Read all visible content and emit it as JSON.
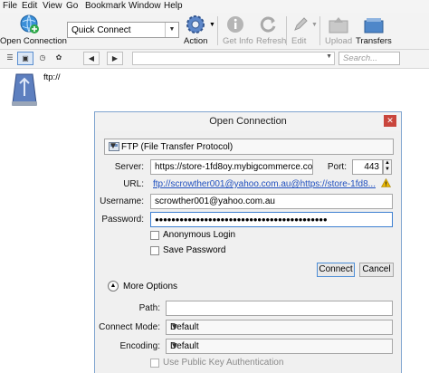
{
  "menu": [
    "File",
    "Edit",
    "View",
    "Go",
    "Bookmark",
    "Window",
    "Help"
  ],
  "toolbar": {
    "open_connection": "Open Connection",
    "quick_connect": "Quick Connect",
    "action": "Action",
    "get_info": "Get Info",
    "refresh": "Refresh",
    "edit": "Edit",
    "upload": "Upload",
    "transfers": "Transfers"
  },
  "nav": {
    "search_placeholder": "Search..."
  },
  "bookmark": {
    "label": "ftp://"
  },
  "dialog": {
    "title": "Open Connection",
    "protocol": "FTP (File Transfer Protocol)",
    "server_label": "Server:",
    "server_value": "https://store-1fd8oy.mybigcommerce.com/dav",
    "port_label": "Port:",
    "port_value": "443",
    "url_label": "URL:",
    "url_value": "ftp://scrowther001@yahoo.com.au@https://store-1fd8...",
    "username_label": "Username:",
    "username_value": "scrowther001@yahoo.com.au",
    "password_label": "Password:",
    "password_value": "●●●●●●●●●●●●●●●●●●●●●●●●●●●●●●●●●●●●●●●●●●",
    "anonymous_login": "Anonymous Login",
    "save_password": "Save Password",
    "connect": "Connect",
    "cancel": "Cancel",
    "more_options": "More Options",
    "path_label": "Path:",
    "connect_mode_label": "Connect Mode:",
    "connect_mode_value": "Default",
    "encoding_label": "Encoding:",
    "encoding_value": "Default",
    "public_key_auth": "Use Public Key Authentication"
  },
  "colors": {
    "accent": "#3c7fd1",
    "link": "#1f4fbf",
    "warning": "#e8b500"
  }
}
